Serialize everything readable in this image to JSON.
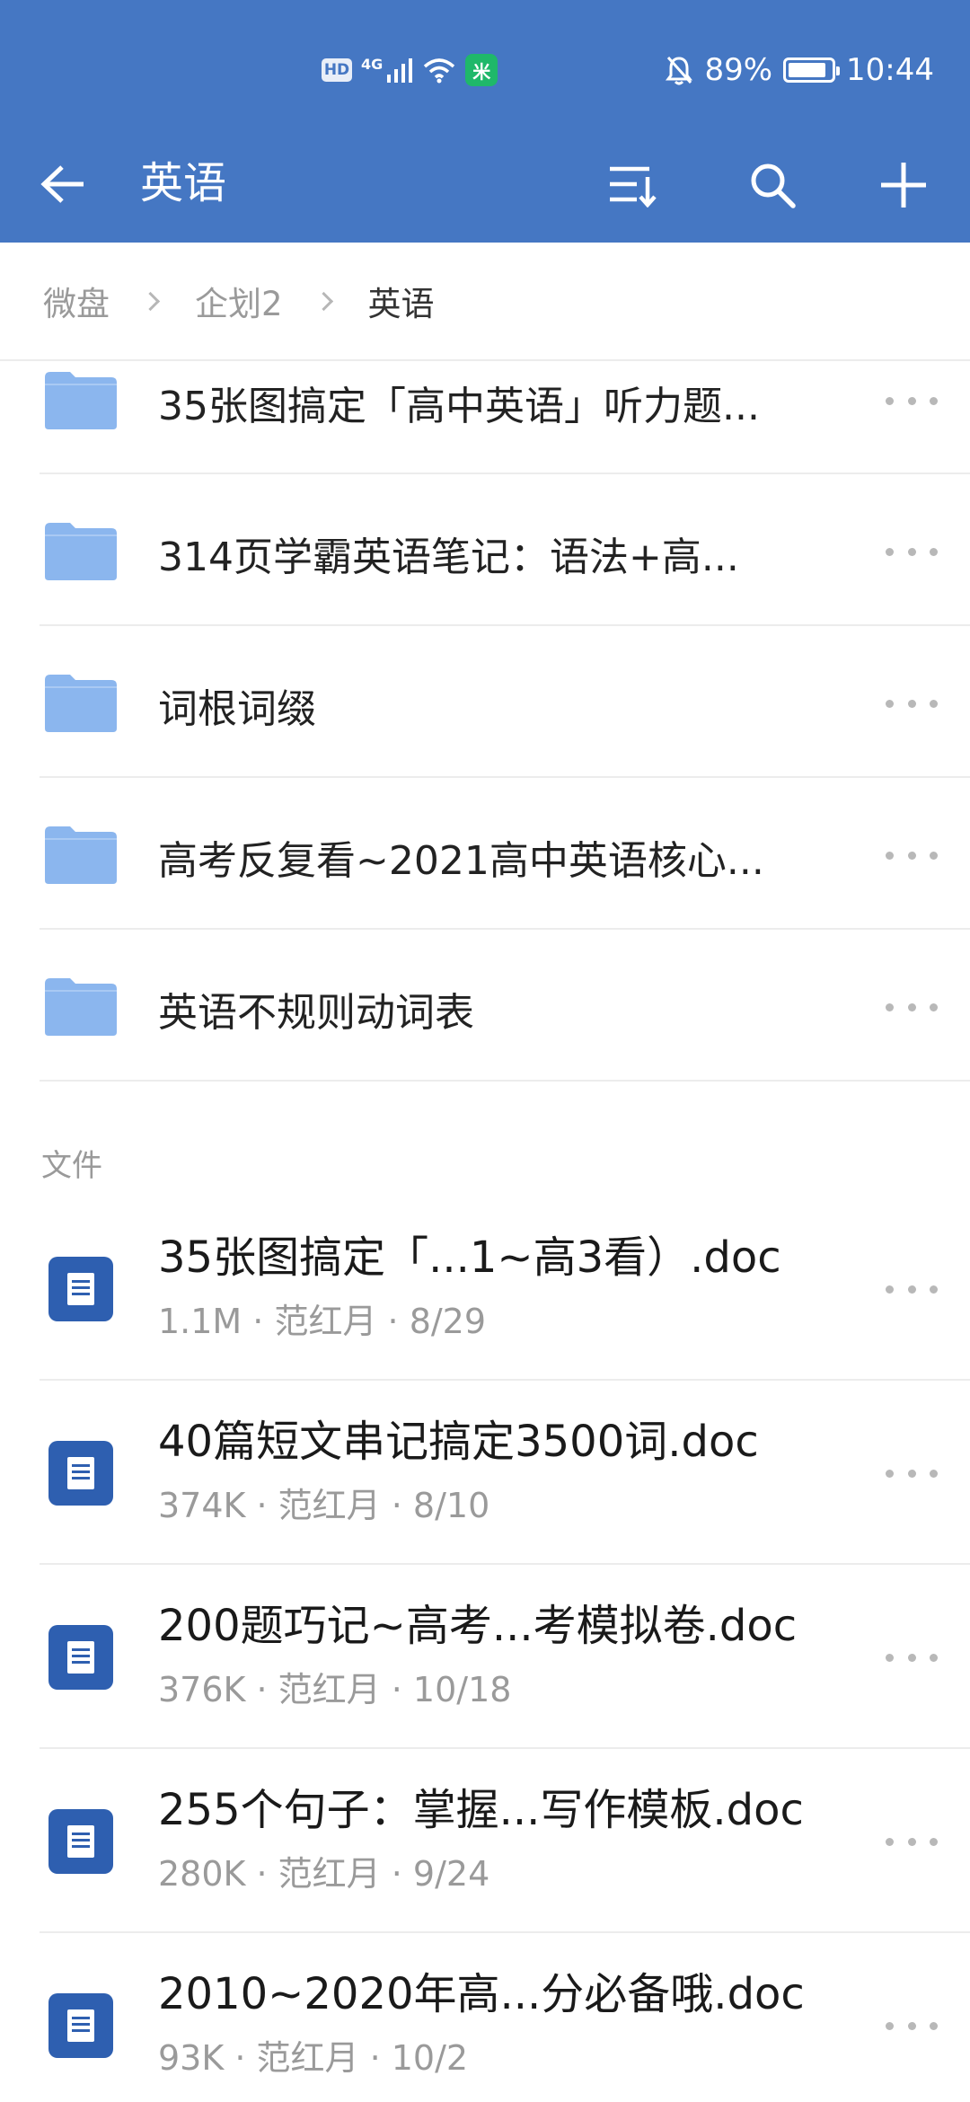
{
  "status_bar": {
    "hd": "HD",
    "network": "4G",
    "app_badge": "米",
    "battery_level": 0.89,
    "battery": "89%",
    "time": "10:44"
  },
  "app_bar": {
    "title": "英语",
    "icons": [
      "back-arrow-icon",
      "sort-icon",
      "search-icon",
      "plus-icon"
    ]
  },
  "breadcrumb": [
    "微盘",
    "企划2",
    "英语"
  ],
  "folders": [
    {
      "name": "35张图搞定「高中英语」听力题..."
    },
    {
      "name": "314页学霸英语笔记：语法+高..."
    },
    {
      "name": "词根词缀"
    },
    {
      "name": "高考反复看~2021高中英语核心..."
    },
    {
      "name": "英语不规则动词表"
    }
  ],
  "files_section_label": "文件",
  "files": [
    {
      "name": "35张图搞定「...1~高3看）.doc",
      "meta": "1.1M · 范红月 · 8/29"
    },
    {
      "name": "40篇短文串记搞定3500词.doc",
      "meta": "374K · 范红月 · 8/10"
    },
    {
      "name": "200题巧记~高考...考模拟卷.doc",
      "meta": "376K · 范红月 · 10/18"
    },
    {
      "name": "255个句子：掌握...写作模板.doc",
      "meta": "280K · 范红月 · 9/24"
    },
    {
      "name": "2010~2020年高...分必备哦.doc",
      "meta": "93K · 范红月 · 10/2"
    }
  ],
  "colors": {
    "header_bg": "#4577c3",
    "folder": "#8bb6ee",
    "doc_icon": "#2e5fb0"
  }
}
